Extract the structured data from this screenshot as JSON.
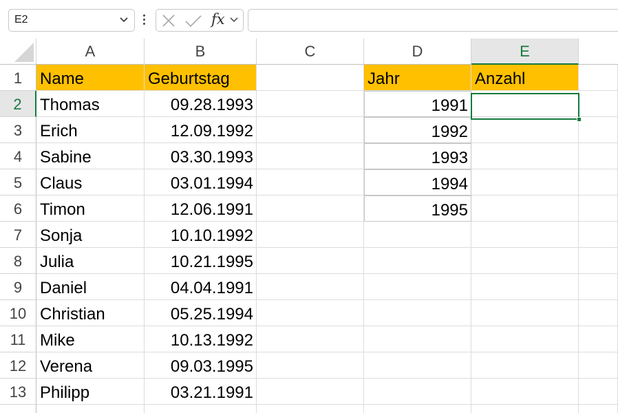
{
  "name_box": {
    "value": "E2"
  },
  "formula_bar": {
    "fx_label": "fx",
    "value": ""
  },
  "columns": [
    "A",
    "B",
    "C",
    "D",
    "E"
  ],
  "selected_column": "E",
  "rows": [
    "1",
    "2",
    "3",
    "4",
    "5",
    "6",
    "7",
    "8",
    "9",
    "10",
    "11",
    "12",
    "13"
  ],
  "selected_row": "2",
  "header_row": {
    "name": "Name",
    "birthday": "Geburtstag",
    "year": "Jahr",
    "count": "Anzahl"
  },
  "people": [
    {
      "name": "Thomas",
      "birthday": "09.28.1993"
    },
    {
      "name": "Erich",
      "birthday": "12.09.1992"
    },
    {
      "name": "Sabine",
      "birthday": "03.30.1993"
    },
    {
      "name": "Claus",
      "birthday": "03.01.1994"
    },
    {
      "name": "Timon",
      "birthday": "12.06.1991"
    },
    {
      "name": "Sonja",
      "birthday": "10.10.1992"
    },
    {
      "name": "Julia",
      "birthday": "10.21.1995"
    },
    {
      "name": "Daniel",
      "birthday": "04.04.1991"
    },
    {
      "name": "Christian",
      "birthday": "05.25.1994"
    },
    {
      "name": "Mike",
      "birthday": "10.13.1992"
    },
    {
      "name": "Verena",
      "birthday": "09.03.1995"
    },
    {
      "name": "Philipp",
      "birthday": "03.21.1991"
    }
  ],
  "years": [
    "1991",
    "1992",
    "1993",
    "1994",
    "1995"
  ],
  "colors": {
    "header_fill": "#ffc000",
    "selection": "#137a3d"
  }
}
